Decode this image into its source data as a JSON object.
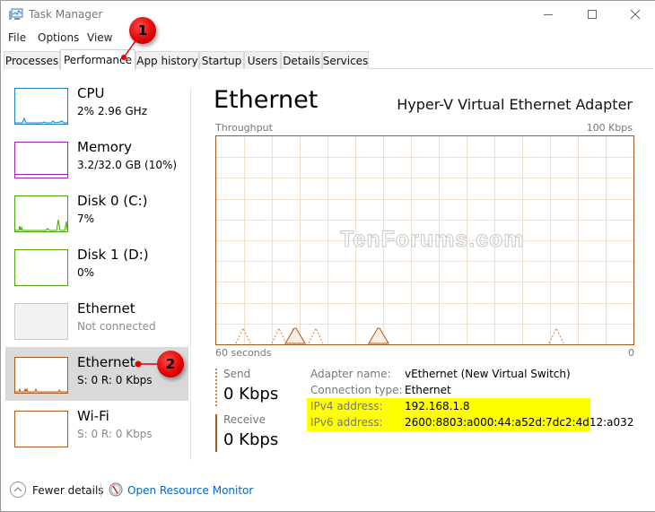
{
  "window": {
    "title": "Task Manager",
    "controls": {
      "minimize": "—",
      "maximize": "☐",
      "close": "✕"
    }
  },
  "menu": [
    "File",
    "Options",
    "View"
  ],
  "tabs": [
    {
      "label": "Processes",
      "active": false
    },
    {
      "label": "Performance",
      "active": true
    },
    {
      "label": "App history",
      "active": false
    },
    {
      "label": "Startup",
      "active": false
    },
    {
      "label": "Users",
      "active": false
    },
    {
      "label": "Details",
      "active": false
    },
    {
      "label": "Services",
      "active": false
    }
  ],
  "sidebar": {
    "items": [
      {
        "name": "CPU",
        "value": "2%  2.96 GHz",
        "color": "#1a7fbd",
        "selected": false,
        "muted": false
      },
      {
        "name": "Memory",
        "value": "3.2/32.0 GB (10%)",
        "color": "#9528b4",
        "selected": false,
        "muted": false
      },
      {
        "name": "Disk 0 (C:)",
        "value": "7%",
        "color": "#4da60c",
        "selected": false,
        "muted": false
      },
      {
        "name": "Disk 1 (D:)",
        "value": "0%",
        "color": "#4da60c",
        "selected": false,
        "muted": false
      },
      {
        "name": "Ethernet",
        "value": "Not connected",
        "color": "#c8c8c8",
        "selected": false,
        "muted": true
      },
      {
        "name": "Ethernet",
        "value": "S: 0 R: 0 Kbps",
        "color": "#a7581f",
        "selected": true,
        "muted": false
      },
      {
        "name": "Wi-Fi",
        "value": "S: 0 R: 0 Kbps",
        "color": "#a7581f",
        "selected": false,
        "muted": true
      }
    ]
  },
  "main": {
    "title": "Ethernet",
    "adapter": "Hyper-V Virtual Ethernet Adapter",
    "graph": {
      "label": "Throughput",
      "max_label": "100 Kbps",
      "x_left_label": "60 seconds",
      "x_right_label": "0",
      "accent": "#a7581f",
      "grid_color": "#f0dfcf"
    },
    "send": {
      "label": "Send",
      "value": "0 Kbps"
    },
    "receive": {
      "label": "Receive",
      "value": "0 Kbps"
    },
    "info": [
      {
        "key": "Adapter name:",
        "value": "vEthernet (New Virtual Switch)"
      },
      {
        "key": "Connection type:",
        "value": "Ethernet"
      },
      {
        "key": "IPv4 address:",
        "value": "192.168.1.8"
      },
      {
        "key": "IPv6 address:",
        "value": "2600:8803:a000:44:a52d:7dc2:4d12:a032"
      }
    ],
    "highlight_color": "#ffff00"
  },
  "footer": {
    "fewer_details": "Fewer details",
    "resource_monitor": "Open Resource Monitor"
  },
  "callouts": [
    "1",
    "2"
  ],
  "watermark": "TenForums.com"
}
